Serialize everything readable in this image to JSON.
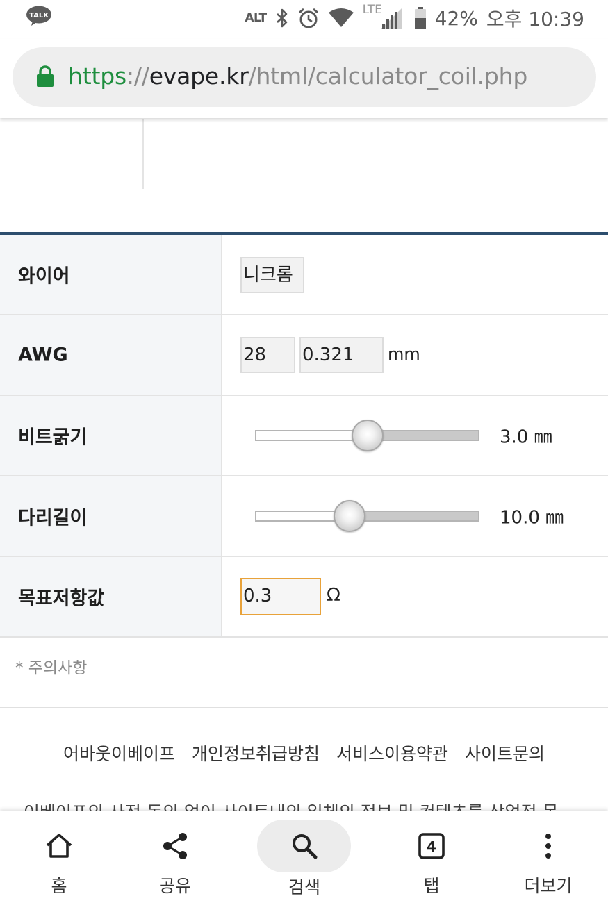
{
  "status_bar": {
    "talk_icon_text": "TALK",
    "alt_text": "ALT",
    "lte_text": "LTE",
    "battery": "42%",
    "time": "오후 10:39",
    "icons": [
      "kakaotalk-icon",
      "bluetooth-icon",
      "alarm-icon",
      "wifi-icon",
      "signal-icon",
      "battery-icon"
    ]
  },
  "address_bar": {
    "scheme": "https",
    "separator": "://",
    "host": "evape.kr",
    "path": "/html/calculator_coil.php",
    "lock_color": "#1e8e3e"
  },
  "form": {
    "wire": {
      "label": "와이어",
      "value": "니크롬"
    },
    "awg": {
      "label": "AWG",
      "gauge": "28",
      "diameter": "0.321",
      "unit": "mm"
    },
    "bit": {
      "label": "비트굵기",
      "value_text": "3.0 ㎜",
      "position": 0.5
    },
    "leg": {
      "label": "다리길이",
      "value_text": "10.0 ㎜",
      "position": 0.42
    },
    "target": {
      "label": "목표저항값",
      "value": "0.3",
      "unit": "Ω"
    }
  },
  "note": "* 주의사항",
  "footer": {
    "links": [
      "어바웃이베이프",
      "개인정보취급방침",
      "서비스이용약관",
      "사이트문의"
    ],
    "cut_text": "이베이프의 사전 동의 없이 사이트내의 일체의 정보 및 컨텐츠를 상업적 목"
  },
  "bottom_nav": {
    "home": "홈",
    "share": "공유",
    "search": "검색",
    "tabs": "탭",
    "tab_count": "4",
    "more": "더보기"
  },
  "colors": {
    "accent_rule": "#2d4e6e",
    "focus_border": "#e8a23a",
    "label_bg": "#f4f6f8"
  }
}
